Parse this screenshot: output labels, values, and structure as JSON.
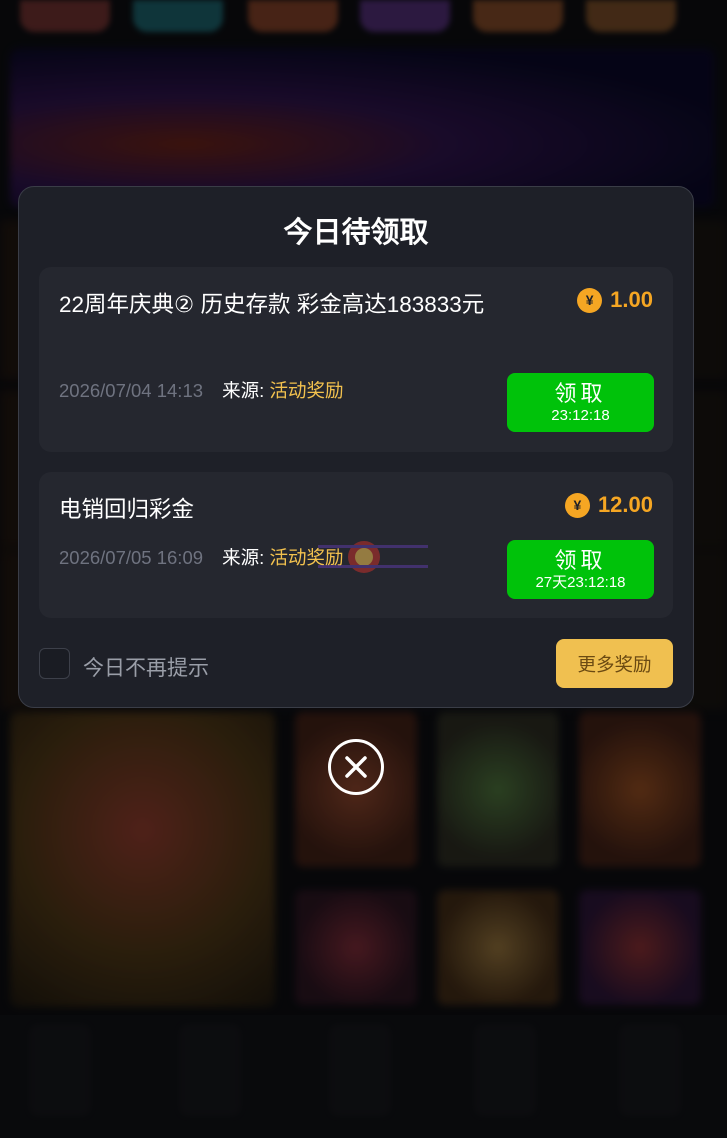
{
  "modal": {
    "title": "今日待领取",
    "rewards": [
      {
        "title": "22周年庆典② 历史存款 彩金高达183833元",
        "amount": "1.00",
        "time": "2026/07/04 14:13",
        "source_label": "来源:",
        "source_value": "活动奖励",
        "claim_label": "领取",
        "countdown": "23:12:18"
      },
      {
        "title": "电销回归彩金",
        "amount": "12.00",
        "time": "2026/07/05 16:09",
        "source_label": "来源:",
        "source_value": "活动奖励",
        "claim_label": "领取",
        "countdown": "27天23:12:18"
      }
    ],
    "dont_show_label": "今日不再提示",
    "more_button": "更多奖励",
    "coin_symbol": "¥"
  },
  "icons": [
    "coin-icon",
    "close-icon"
  ],
  "colors": {
    "modal_bg": "#1e2028",
    "card_bg": "#25272f",
    "accent_gold": "#f5a623",
    "claim_green": "#00c20a",
    "more_button": "#f0c050",
    "source_text": "#f2c14e"
  }
}
